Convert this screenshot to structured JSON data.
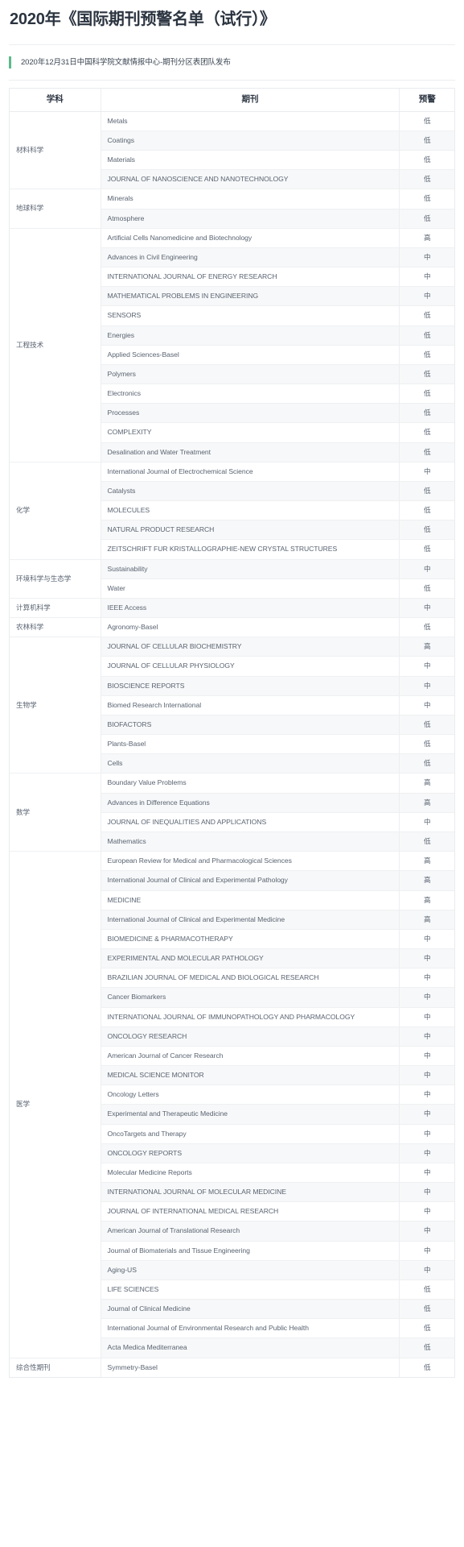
{
  "header": {
    "title": "2020年《国际期刊预警名单（试行）》",
    "byline": "2020年12月31日中国科学院文献情报中心-期刊分区表团队发布",
    "accent_color": "#5cb98b"
  },
  "table": {
    "columns": [
      "学科",
      "期刊",
      "预警"
    ],
    "warning_levels": {
      "high": "高",
      "medium": "中",
      "low": "低"
    },
    "groups": [
      {
        "subject": "材料科学",
        "rows": [
          {
            "journal": "Metals",
            "warning": "低"
          },
          {
            "journal": "Coatings",
            "warning": "低"
          },
          {
            "journal": "Materials",
            "warning": "低"
          },
          {
            "journal": "JOURNAL OF NANOSCIENCE AND NANOTECHNOLOGY",
            "warning": "低"
          }
        ]
      },
      {
        "subject": "地球科学",
        "rows": [
          {
            "journal": "Minerals",
            "warning": "低"
          },
          {
            "journal": "Atmosphere",
            "warning": "低"
          }
        ]
      },
      {
        "subject": "工程技术",
        "rows": [
          {
            "journal": "Artificial Cells Nanomedicine and Biotechnology",
            "warning": "高"
          },
          {
            "journal": "Advances in Civil Engineering",
            "warning": "中"
          },
          {
            "journal": "INTERNATIONAL JOURNAL OF ENERGY RESEARCH",
            "warning": "中"
          },
          {
            "journal": "MATHEMATICAL PROBLEMS IN ENGINEERING",
            "warning": "中"
          },
          {
            "journal": "SENSORS",
            "warning": "低"
          },
          {
            "journal": "Energies",
            "warning": "低"
          },
          {
            "journal": "Applied Sciences-Basel",
            "warning": "低"
          },
          {
            "journal": "Polymers",
            "warning": "低"
          },
          {
            "journal": "Electronics",
            "warning": "低"
          },
          {
            "journal": "Processes",
            "warning": "低"
          },
          {
            "journal": "COMPLEXITY",
            "warning": "低"
          },
          {
            "journal": "Desalination and Water Treatment",
            "warning": "低"
          }
        ]
      },
      {
        "subject": "化学",
        "rows": [
          {
            "journal": "International Journal of Electrochemical Science",
            "warning": "中"
          },
          {
            "journal": "Catalysts",
            "warning": "低"
          },
          {
            "journal": "MOLECULES",
            "warning": "低"
          },
          {
            "journal": "NATURAL PRODUCT RESEARCH",
            "warning": "低"
          },
          {
            "journal": "ZEITSCHRIFT FUR KRISTALLOGRAPHIE-NEW CRYSTAL STRUCTURES",
            "warning": "低"
          }
        ]
      },
      {
        "subject": "环境科学与生态学",
        "rows": [
          {
            "journal": "Sustainability",
            "warning": "中"
          },
          {
            "journal": "Water",
            "warning": "低"
          }
        ]
      },
      {
        "subject": "计算机科学",
        "rows": [
          {
            "journal": "IEEE Access",
            "warning": "中"
          }
        ]
      },
      {
        "subject": "农林科学",
        "rows": [
          {
            "journal": "Agronomy-Basel",
            "warning": "低"
          }
        ]
      },
      {
        "subject": "生物学",
        "rows": [
          {
            "journal": "JOURNAL OF CELLULAR BIOCHEMISTRY",
            "warning": "高"
          },
          {
            "journal": "JOURNAL OF CELLULAR PHYSIOLOGY",
            "warning": "中"
          },
          {
            "journal": "BIOSCIENCE REPORTS",
            "warning": "中"
          },
          {
            "journal": "Biomed Research International",
            "warning": "中"
          },
          {
            "journal": "BIOFACTORS",
            "warning": "低"
          },
          {
            "journal": "Plants-Basel",
            "warning": "低"
          },
          {
            "journal": "Cells",
            "warning": "低"
          }
        ]
      },
      {
        "subject": "数学",
        "rows": [
          {
            "journal": "Boundary Value Problems",
            "warning": "高"
          },
          {
            "journal": "Advances in Difference Equations",
            "warning": "高"
          },
          {
            "journal": "JOURNAL OF INEQUALITIES AND APPLICATIONS",
            "warning": "中"
          },
          {
            "journal": "Mathematics",
            "warning": "低"
          }
        ]
      },
      {
        "subject": "医学",
        "rows": [
          {
            "journal": "European Review for Medical and Pharmacological Sciences",
            "warning": "高"
          },
          {
            "journal": "International Journal of Clinical and Experimental Pathology",
            "warning": "高"
          },
          {
            "journal": "MEDICINE",
            "warning": "高"
          },
          {
            "journal": "International Journal of Clinical and Experimental Medicine",
            "warning": "高"
          },
          {
            "journal": "BIOMEDICINE & PHARMACOTHERAPY",
            "warning": "中"
          },
          {
            "journal": "EXPERIMENTAL AND MOLECULAR PATHOLOGY",
            "warning": "中"
          },
          {
            "journal": "BRAZILIAN JOURNAL OF MEDICAL AND BIOLOGICAL RESEARCH",
            "warning": "中"
          },
          {
            "journal": "Cancer Biomarkers",
            "warning": "中"
          },
          {
            "journal": "INTERNATIONAL JOURNAL OF IMMUNOPATHOLOGY AND PHARMACOLOGY",
            "warning": "中"
          },
          {
            "journal": "ONCOLOGY RESEARCH",
            "warning": "中"
          },
          {
            "journal": "American Journal of Cancer Research",
            "warning": "中"
          },
          {
            "journal": "MEDICAL SCIENCE MONITOR",
            "warning": "中"
          },
          {
            "journal": "Oncology Letters",
            "warning": "中"
          },
          {
            "journal": "Experimental and Therapeutic Medicine",
            "warning": "中"
          },
          {
            "journal": "OncoTargets and Therapy",
            "warning": "中"
          },
          {
            "journal": "ONCOLOGY REPORTS",
            "warning": "中"
          },
          {
            "journal": "Molecular Medicine Reports",
            "warning": "中"
          },
          {
            "journal": "INTERNATIONAL JOURNAL OF MOLECULAR MEDICINE",
            "warning": "中"
          },
          {
            "journal": "JOURNAL OF INTERNATIONAL MEDICAL RESEARCH",
            "warning": "中"
          },
          {
            "journal": "American Journal of Translational Research",
            "warning": "中"
          },
          {
            "journal": "Journal of Biomaterials and Tissue Engineering",
            "warning": "中"
          },
          {
            "journal": "Aging-US",
            "warning": "中"
          },
          {
            "journal": "LIFE SCIENCES",
            "warning": "低"
          },
          {
            "journal": "Journal of Clinical Medicine",
            "warning": "低"
          },
          {
            "journal": "International Journal of Environmental Research and Public Health",
            "warning": "低"
          },
          {
            "journal": "Acta Medica Mediterranea",
            "warning": "低"
          }
        ]
      },
      {
        "subject": "综合性期刊",
        "rows": [
          {
            "journal": "Symmetry-Basel",
            "warning": "低"
          }
        ]
      }
    ]
  }
}
